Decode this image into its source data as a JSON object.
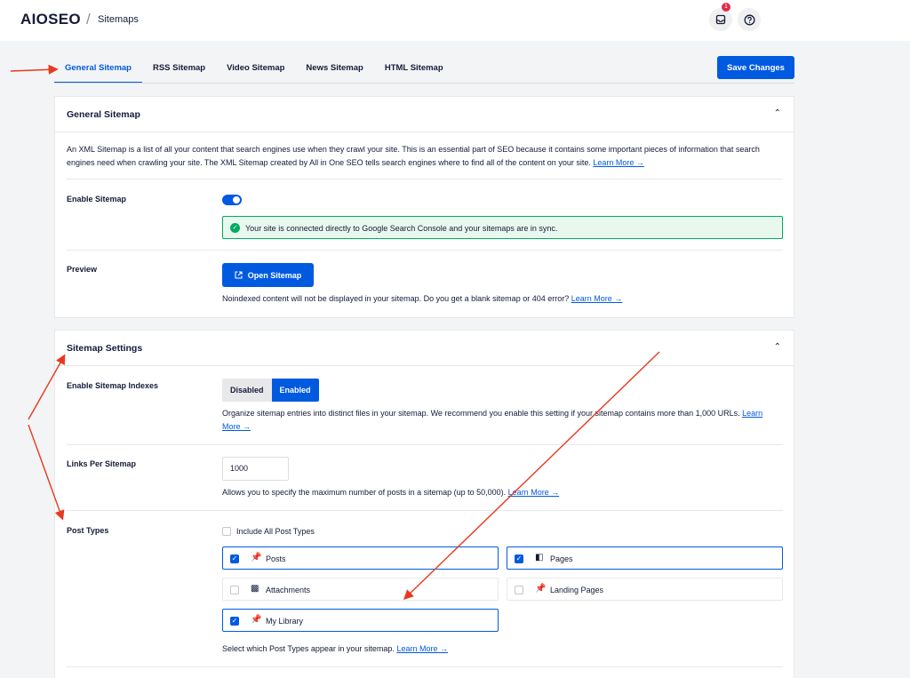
{
  "header": {
    "logo": "AIOSEO",
    "separator": "/",
    "breadcrumb": "Sitemaps",
    "notification_count": "1"
  },
  "tabs": [
    {
      "label": "General Sitemap",
      "active": true
    },
    {
      "label": "RSS Sitemap"
    },
    {
      "label": "Video Sitemap"
    },
    {
      "label": "News Sitemap"
    },
    {
      "label": "HTML Sitemap"
    }
  ],
  "save_button": "Save Changes",
  "general": {
    "title": "General Sitemap",
    "description": "An XML Sitemap is a list of all your content that search engines use when they crawl your site. This is an essential part of SEO because it contains some important pieces of information that search engines need when crawling your site. The XML Sitemap created by All in One SEO tells search engines where to find all of the content on your site.",
    "learn_more": "Learn More →",
    "enable_label": "Enable Sitemap",
    "alert": "Your site is connected directly to Google Search Console and your sitemaps are in sync.",
    "preview_label": "Preview",
    "open_button": "Open Sitemap",
    "preview_help": "Noindexed content will not be displayed in your sitemap. Do you get a blank sitemap or 404 error?"
  },
  "settings": {
    "title": "Sitemap Settings",
    "indexes_label": "Enable Sitemap Indexes",
    "disabled": "Disabled",
    "enabled": "Enabled",
    "indexes_help": "Organize sitemap entries into distinct files in your sitemap. We recommend you enable this setting if your sitemap contains more than 1,000 URLs.",
    "links_label": "Links Per Sitemap",
    "links_value": "1000",
    "links_help": "Allows you to specify the maximum number of posts in a sitemap (up to 50,000).",
    "post_types_label": "Post Types",
    "include_all": "Include All Post Types",
    "post_types": [
      {
        "label": "Posts",
        "checked": true
      },
      {
        "label": "Pages",
        "checked": true
      },
      {
        "label": "Attachments",
        "checked": false
      },
      {
        "label": "Landing Pages",
        "checked": false
      },
      {
        "label": "My Library",
        "checked": true
      }
    ],
    "post_types_help": "Select which Post Types appear in your sitemap."
  },
  "colors": {
    "accent": "#005ae0",
    "success": "#00aa63",
    "annotation": "#e8391e"
  }
}
